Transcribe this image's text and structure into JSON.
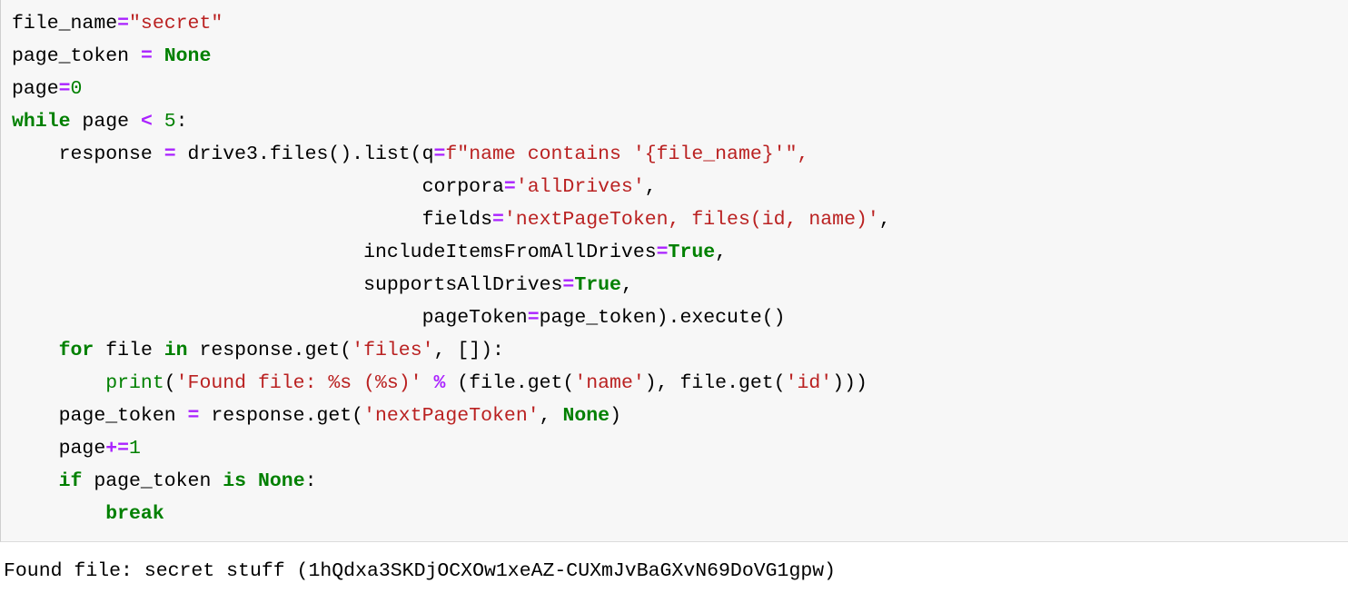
{
  "code_block": {
    "language": "python",
    "background_color": "#f7f7f7",
    "border_color": "#dcdcdc",
    "lines": [
      "file_name=\"secret\"",
      "page_token = None",
      "page=0",
      "while page < 5:",
      "    response = drive3.files().list(q=f\"name contains '{file_name}'\",",
      "                                   corpora='allDrives',",
      "                                   fields='nextPageToken, files(id, name)',",
      "                              includeItemsFromAllDrives=True,",
      "                              supportsAllDrives=True,",
      "                                   pageToken=page_token).execute()",
      "    for file in response.get('files', []):",
      "        print('Found file: %s (%s)' % (file.get('name'), file.get('id')))",
      "    page_token = response.get('nextPageToken', None)",
      "    page+=1",
      "    if page_token is None:",
      "        break"
    ],
    "tokens": {
      "line1": {
        "var": "file_name",
        "op": "=",
        "string": "\"secret\""
      },
      "line2": {
        "var": "page_token",
        "op": "=",
        "const": "None"
      },
      "line3": {
        "var": "page",
        "op": "=",
        "number": "0"
      },
      "line4": {
        "keyword": "while",
        "var": "page",
        "op": "<",
        "number": "5",
        "colon": ":"
      },
      "line5": {
        "var": "response",
        "op": "=",
        "call": "drive3.files().list(",
        "kwarg": "q",
        "fstring_prefix": "f\"name contains ",
        "fstring_expr": "'{file_name}'",
        "fstring_suffix": "\","
      },
      "line6": {
        "kwarg": "corpora",
        "op": "=",
        "string": "'allDrives'",
        "comma": ","
      },
      "line7": {
        "kwarg": "fields",
        "op": "=",
        "string": "'nextPageToken, files(id, name)'",
        "comma": ","
      },
      "line8": {
        "kwarg": "includeItemsFromAllDrives",
        "op": "=",
        "const": "True",
        "comma": ","
      },
      "line9": {
        "kwarg": "supportsAllDrives",
        "op": "=",
        "const": "True",
        "comma": ","
      },
      "line10": {
        "kwarg": "pageToken",
        "op": "=",
        "value": "page_token",
        "tail": ").execute()"
      },
      "line11": {
        "keyword_for": "for",
        "var": "file",
        "keyword_in": "in",
        "call": "response.get(",
        "string": "'files'",
        "tail": ", []):"
      },
      "line12": {
        "builtin": "print",
        "string": "'Found file: %s (%s)'",
        "op": "%",
        "args_open": " (file.get(",
        "arg1": "'name'",
        "mid": "), file.get(",
        "arg2": "'id'",
        "tail": ")))"
      },
      "line13": {
        "var": "page_token",
        "op": "=",
        "call": "response.get(",
        "string": "'nextPageToken'",
        "comma": ", ",
        "const": "None",
        "tail": ")"
      },
      "line14": {
        "var": "page",
        "op": "+=",
        "number": "1"
      },
      "line15": {
        "keyword_if": "if",
        "var": "page_token",
        "keyword_is": "is",
        "const": "None",
        "colon": ":"
      },
      "line16": {
        "keyword": "break"
      }
    },
    "colors": {
      "keyword": "#008000",
      "builtin": "#008000",
      "string": "#ba2121",
      "operator": "#aa22ff",
      "number": "#008000",
      "plain": "#000000"
    }
  },
  "output": {
    "text": "Found file: secret stuff (1hQdxa3SKDjOCXOw1xeAZ-CUXmJvBaGXvN69DoVG1gpw)",
    "prefix": "Found file: ",
    "file_name": "secret stuff",
    "file_id": "1hQdxa3SKDjOCXOw1xeAZ-CUXmJvBaGXvN69DoVG1gpw",
    "color": "#000000"
  }
}
